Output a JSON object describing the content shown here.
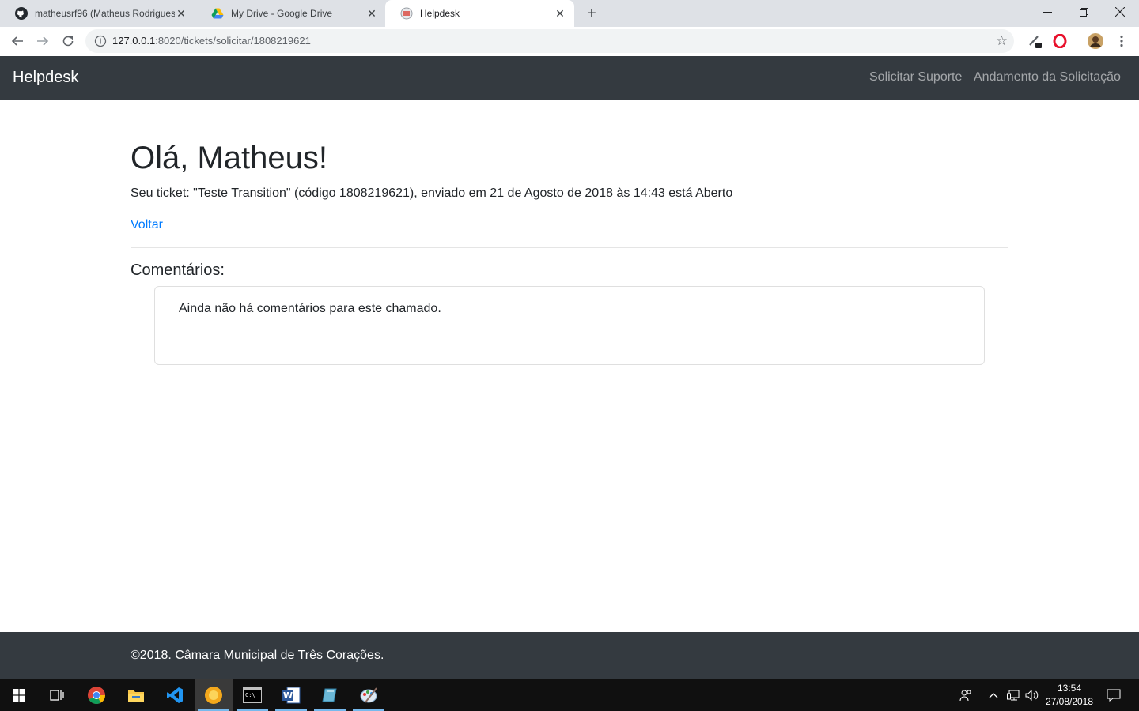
{
  "browser": {
    "tabs": [
      {
        "title": "matheusrf96 (Matheus Rodrigues",
        "icon": "github-icon"
      },
      {
        "title": "My Drive - Google Drive",
        "icon": "google-drive-icon"
      },
      {
        "title": "Helpdesk",
        "icon": "helpdesk-favicon"
      }
    ],
    "url_host": "127.0.0.1",
    "url_path": ":8020/tickets/solicitar/1808219621"
  },
  "navbar": {
    "brand": "Helpdesk",
    "links": [
      "Solicitar Suporte",
      "Andamento da Solicitação"
    ]
  },
  "main": {
    "greeting": "Olá, Matheus!",
    "status": "Seu ticket: \"Teste Transition\" (código 1808219621), enviado em 21 de Agosto de 2018 às 14:43 está Aberto",
    "back_link": "Voltar",
    "comments_heading": "Comentários:",
    "comments_empty": "Ainda não há comentários para este chamado."
  },
  "footer": {
    "text": "©2018. Câmara Municipal de Três Corações."
  },
  "taskbar": {
    "time": "13:54",
    "date": "27/08/2018"
  },
  "colors": {
    "navbar_bg": "#343a40",
    "link": "#007bff",
    "tabstrip_bg": "#dee1e6"
  }
}
